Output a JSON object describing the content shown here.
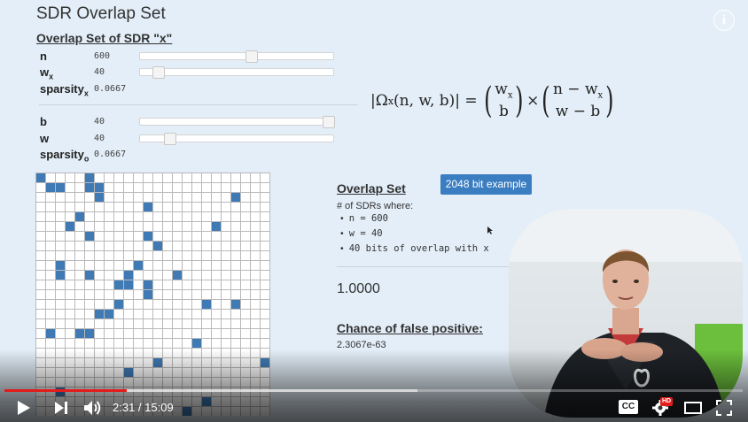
{
  "title": "SDR Overlap Set",
  "subheading": "Overlap Set of SDR \"x\"",
  "params_x": [
    {
      "label": "n",
      "value": "600",
      "level": 0.58
    },
    {
      "label": "w",
      "sub": "x",
      "value": "40",
      "level": 0.07
    },
    {
      "label": "sparsity",
      "sub": "x",
      "value": "0.0667"
    }
  ],
  "params_o": [
    {
      "label": "b",
      "value": "40",
      "level": 1.0
    },
    {
      "label": "w",
      "value": "40",
      "level": 0.13
    },
    {
      "label": "sparsity",
      "sub": "o",
      "value": "0.0667"
    }
  ],
  "formula": {
    "lhs_prefix": "|Ω",
    "lhs_sub": "x",
    "lhs_args": "(n, w, b)| =",
    "b1_top": "w",
    "b1_top_sub": "x",
    "b1_bottom": "b",
    "times": "×",
    "b2_top": "n − w",
    "b2_top_sub": "x",
    "b2_bottom": "w − b"
  },
  "grid": {
    "cols": 24,
    "rows": 24,
    "active_color": "#3f7ab5",
    "active": [
      [
        0,
        0
      ],
      [
        1,
        1
      ],
      [
        2,
        1
      ],
      [
        5,
        0
      ],
      [
        5,
        1
      ],
      [
        6,
        2
      ],
      [
        6,
        1
      ],
      [
        11,
        3
      ],
      [
        20,
        2
      ],
      [
        4,
        4
      ],
      [
        3,
        5
      ],
      [
        18,
        5
      ],
      [
        5,
        6
      ],
      [
        11,
        6
      ],
      [
        12,
        7
      ],
      [
        2,
        9
      ],
      [
        10,
        9
      ],
      [
        2,
        10
      ],
      [
        5,
        10
      ],
      [
        9,
        10
      ],
      [
        14,
        10
      ],
      [
        8,
        11
      ],
      [
        9,
        11
      ],
      [
        11,
        11
      ],
      [
        11,
        12
      ],
      [
        8,
        13
      ],
      [
        17,
        13
      ],
      [
        20,
        13
      ],
      [
        6,
        14
      ],
      [
        7,
        14
      ],
      [
        1,
        16
      ],
      [
        4,
        16
      ],
      [
        5,
        16
      ],
      [
        16,
        17
      ],
      [
        12,
        19
      ],
      [
        23,
        19
      ],
      [
        9,
        20
      ],
      [
        2,
        22
      ],
      [
        17,
        23
      ],
      [
        15,
        24
      ]
    ]
  },
  "overlap": {
    "title": "Overlap Set",
    "example_button": "2048 bit example",
    "where_label": "# of SDRs where:",
    "bullets": [
      "n = 600",
      "w = 40",
      "40 bits of overlap with x"
    ],
    "result": "1.0000",
    "fp_title": "Chance of false positive:",
    "fp_value": "2.3067e-63"
  },
  "player": {
    "current_time": "2:31",
    "separator": " / ",
    "duration": "15:09",
    "played_fraction": 0.166,
    "buffered_fraction": 0.56,
    "cc_label": "CC",
    "hd_badge": "HD",
    "progress_color": "#e31b1b"
  }
}
